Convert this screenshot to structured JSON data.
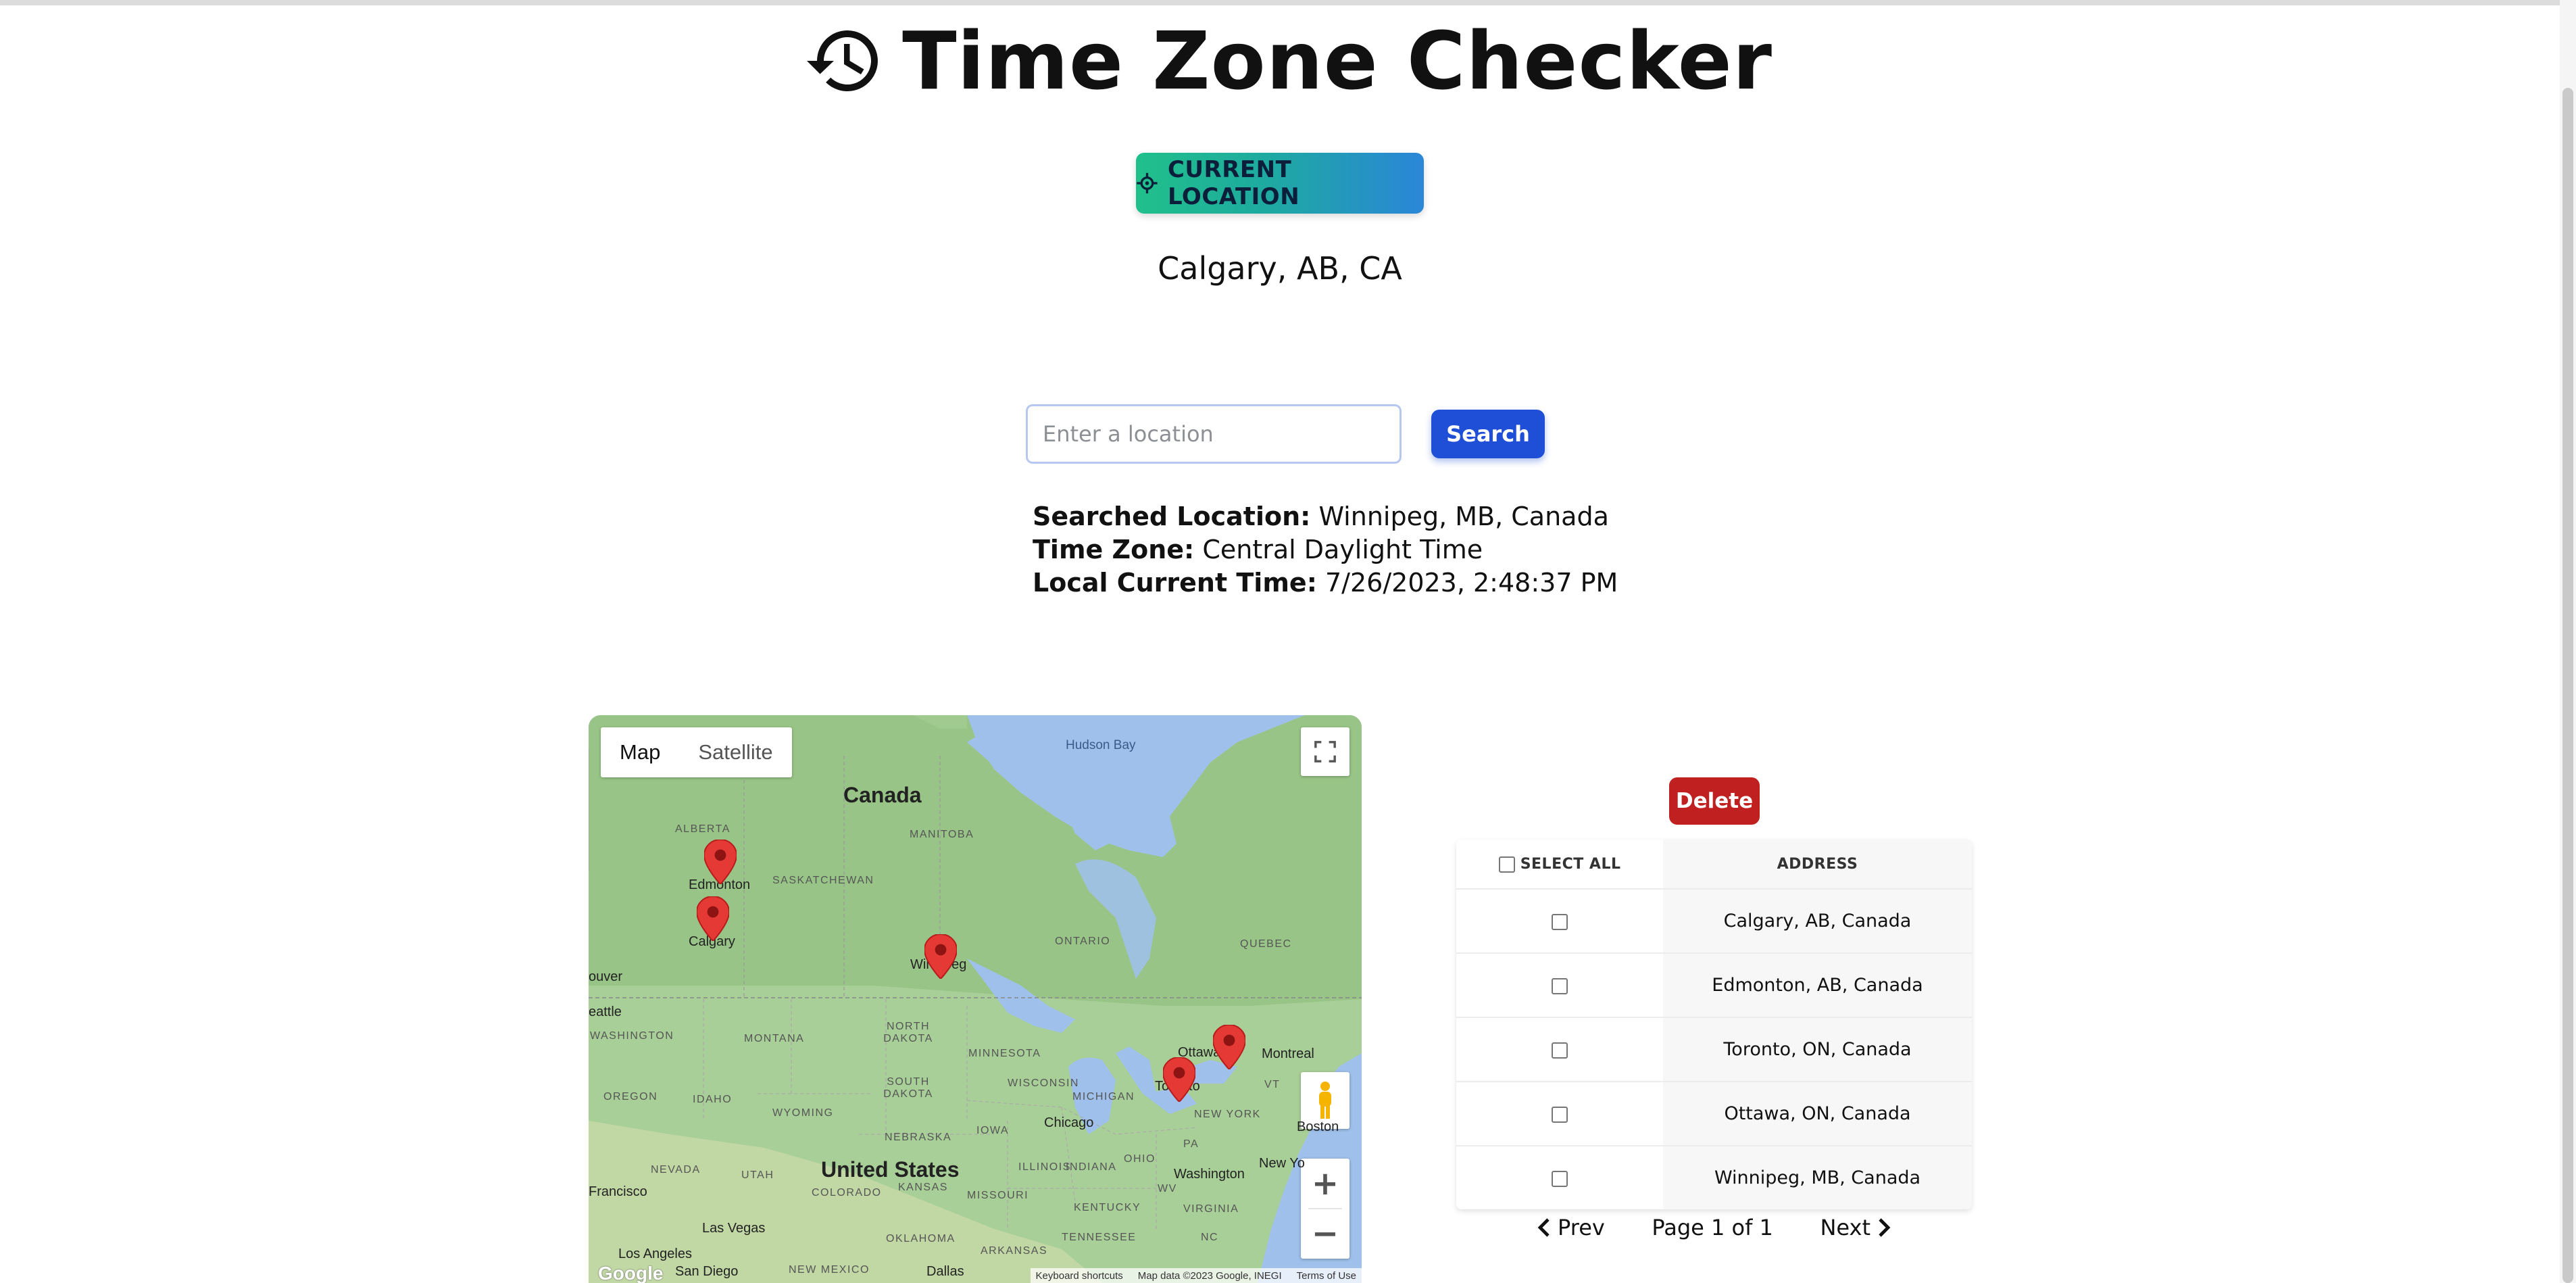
{
  "header": {
    "title": "Time Zone Checker",
    "icon": "history-icon"
  },
  "current_location": {
    "button_label": "CURRENT LOCATION",
    "icon": "crosshair-icon",
    "city": "Calgary, AB, CA"
  },
  "search": {
    "placeholder": "Enter a location",
    "value": "",
    "button_label": "Search"
  },
  "result": {
    "searched_label": "Searched Location:",
    "searched_value": "Winnipeg, MB, Canada",
    "timezone_label": "Time Zone:",
    "timezone_value": "Central Daylight Time",
    "time_label": "Local Current Time:",
    "time_value": "7/26/2023, 2:48:37 PM"
  },
  "map": {
    "type_options": [
      "Map",
      "Satellite"
    ],
    "active_type": "Map",
    "labels": {
      "canada": "Canada",
      "united_states": "United States",
      "hudson_bay": "Hudson Bay",
      "alberta": "ALBERTA",
      "manitoba": "MANITOBA",
      "saskatchewan": "SASKATCHEWAN",
      "ontario": "ONTARIO",
      "quebec": "QUEBEC",
      "washington": "WASHINGTON",
      "montana": "MONTANA",
      "north_dakota": "NORTH DAKOTA",
      "minnesota": "MINNESOTA",
      "oregon": "OREGON",
      "idaho": "IDAHO",
      "wyoming": "WYOMING",
      "south_dakota": "SOUTH DAKOTA",
      "wisconsin": "WISCONSIN",
      "michigan": "MICHIGAN",
      "vt": "VT",
      "nebraska": "NEBRASKA",
      "iowa": "IOWA",
      "new_york": "NEW YORK",
      "nevada": "NEVADA",
      "utah": "UTAH",
      "colorado": "COLORADO",
      "kansas": "KANSAS",
      "missouri": "MISSOURI",
      "illinois": "ILLINOIS",
      "indiana": "INDIANA",
      "ohio": "OHIO",
      "pa": "PA",
      "wv": "WV",
      "kentucky": "KENTUCKY",
      "virginia": "VIRGINIA",
      "tennessee": "TENNESSEE",
      "nc": "NC",
      "oklahoma": "OKLAHOMA",
      "arkansas": "ARKANSAS",
      "new_mexico": "NEW MEXICO",
      "edmonton": "Edmonton",
      "calgary": "Calgary",
      "winnipeg": "Winnipeg",
      "ottawa": "Ottawa",
      "toronto": "Toronto",
      "montreal": "Montreal",
      "boston": "Boston",
      "chicago": "Chicago",
      "washington_dc": "Washington",
      "new_york_city": "New Yo",
      "vancouver": "ouver",
      "seattle": "eattle",
      "san_francisco": "Francisco",
      "las_vegas": "Las Vegas",
      "los_angeles": "Los Angeles",
      "san_diego": "San Diego",
      "dallas": "Dallas",
      "google": "Google"
    },
    "markers": [
      "Edmonton",
      "Calgary",
      "Winnipeg",
      "Ottawa",
      "Toronto"
    ],
    "attribution": {
      "shortcuts": "Keyboard shortcuts",
      "data": "Map data ©2023 Google, INEGI",
      "terms": "Terms of Use"
    },
    "zoom_in": "+",
    "zoom_out": "−"
  },
  "table": {
    "delete_label": "Delete",
    "select_all_label": "SELECT ALL",
    "address_header": "ADDRESS",
    "rows": [
      {
        "address": "Calgary, AB, Canada",
        "checked": false
      },
      {
        "address": "Edmonton, AB, Canada",
        "checked": false
      },
      {
        "address": "Toronto, ON, Canada",
        "checked": false
      },
      {
        "address": "Ottawa, ON, Canada",
        "checked": false
      },
      {
        "address": "Winnipeg, MB, Canada",
        "checked": false
      }
    ]
  },
  "pagination": {
    "prev_label": "Prev",
    "page_text": "Page 1 of 1",
    "next_label": "Next"
  },
  "colors": {
    "accent_blue": "#1f4fd6",
    "delete_red": "#c0201f",
    "pin_red": "#e53935",
    "gradient_start": "#20c08a",
    "gradient_end": "#2a86d8"
  }
}
